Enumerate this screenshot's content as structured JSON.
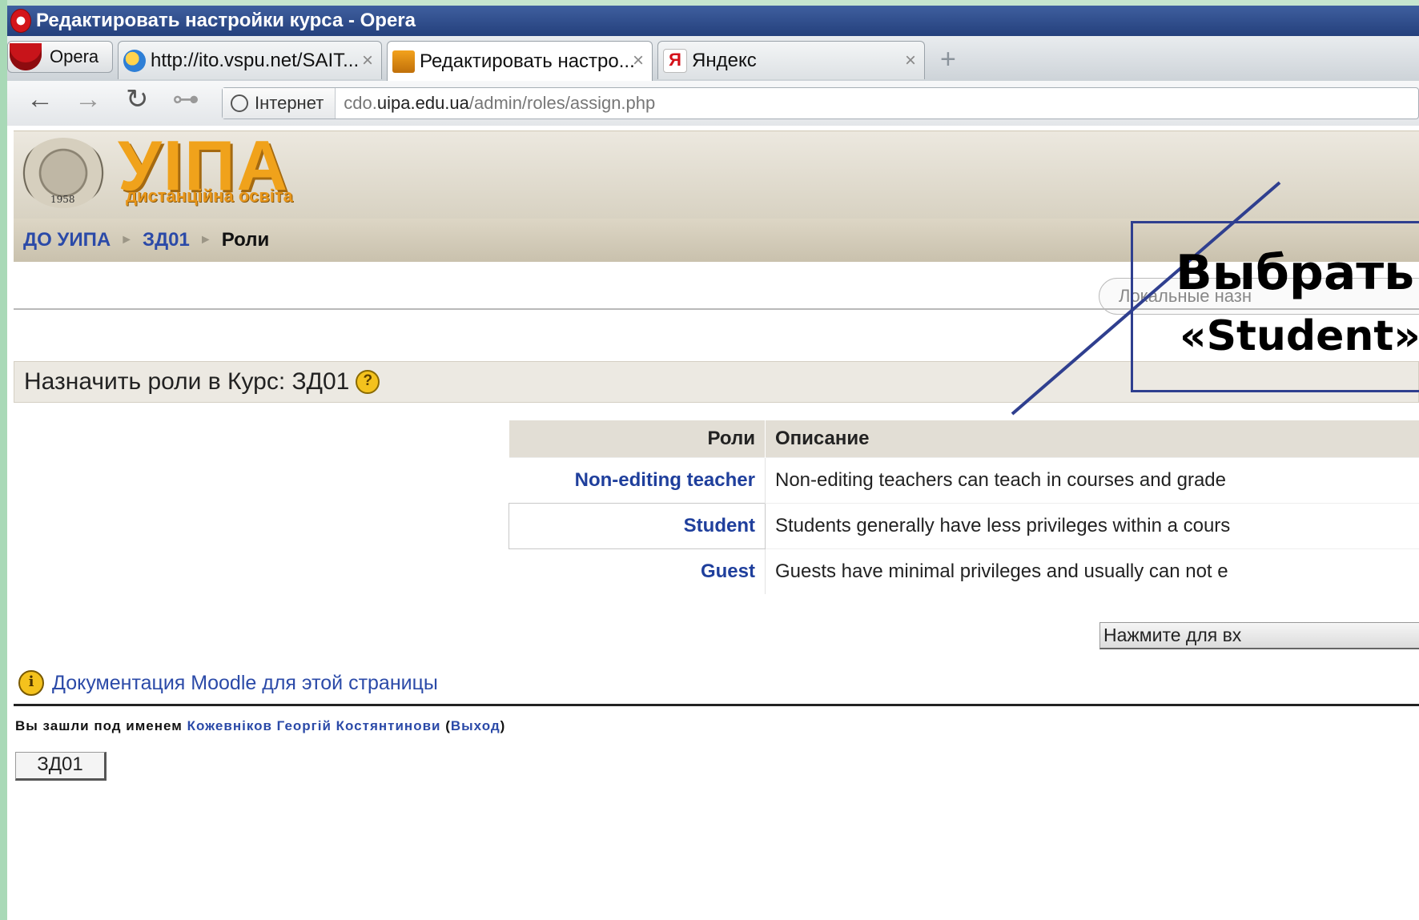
{
  "window": {
    "title": "Редактировать настройки курса - Opera"
  },
  "browser": {
    "menu_label": "Opera",
    "tabs": [
      {
        "label": "http://ito.vspu.net/SAIT...",
        "close": "×"
      },
      {
        "label": "Редактировать настро...",
        "close": "×"
      },
      {
        "label": "Яндекс",
        "close": "×"
      }
    ],
    "new_tab": "+",
    "nav": {
      "back": "←",
      "forward": "→",
      "reload": "↻",
      "key": "⊶"
    },
    "zone_label": "Інтернет",
    "url_prefix": "cdo.",
    "url_domain": "uipa.edu.ua",
    "url_path": "/admin/roles/assign.php"
  },
  "site": {
    "brand": "УІПА",
    "brand_sub": "дистанційна освіта",
    "seal_year": "1958"
  },
  "breadcrumb": {
    "home": "ДО УИПА",
    "course": "ЗД01",
    "current": "Роли",
    "sep": "►"
  },
  "local_pill": "Локальные назн",
  "section": {
    "title": "Назначить роли в Курс: ЗД01",
    "help": "?"
  },
  "roles_table": {
    "headers": [
      "Роли",
      "Описание"
    ],
    "rows": [
      {
        "role": "Non-editing teacher",
        "desc": "Non-editing teachers can teach in courses and grade"
      },
      {
        "role": "Student",
        "desc": "Students generally have less privileges within a cours"
      },
      {
        "role": "Guest",
        "desc": "Guests have minimal privileges and usually can not e"
      }
    ]
  },
  "submit_label": "Нажмите для вх",
  "docs": {
    "icon": "i",
    "label": "Документация Moodle для этой страницы"
  },
  "login": {
    "prefix": "Вы зашли под именем ",
    "user": "Кожевніков Георгій Костянтинови",
    "logout": "Выход"
  },
  "course_button": "ЗД01",
  "annotation": {
    "line1": "Выбрать",
    "line2": "«Student»",
    "color": "#2f3f8f"
  }
}
